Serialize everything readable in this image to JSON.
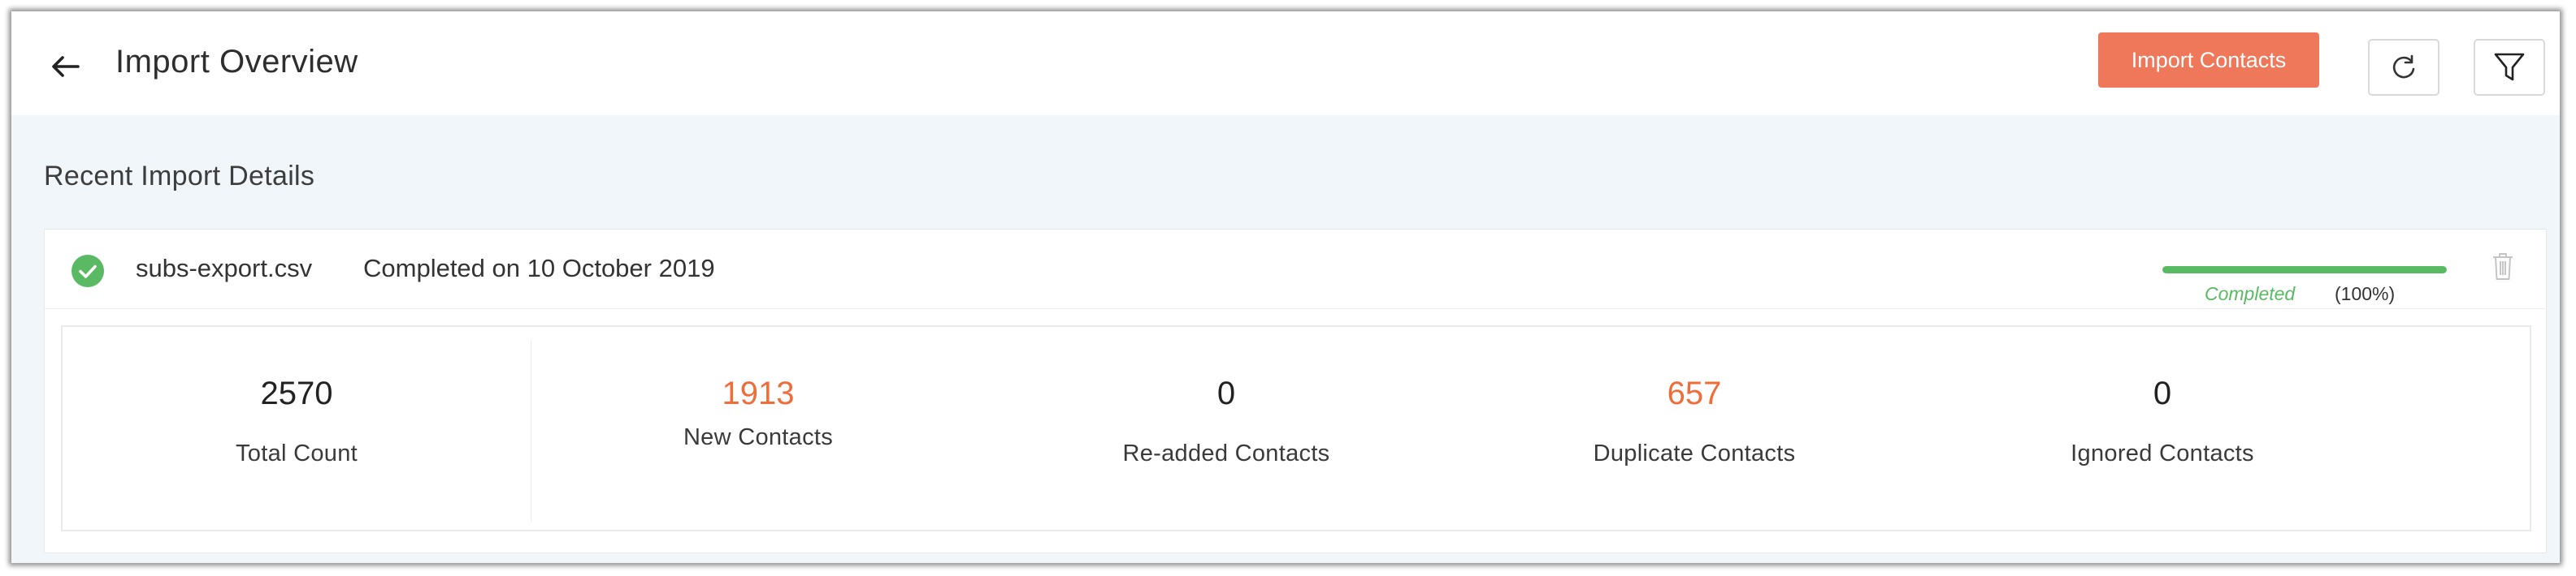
{
  "header": {
    "title": "Import Overview",
    "import_button_label": "Import Contacts"
  },
  "section": {
    "title": "Recent Import Details"
  },
  "import_item": {
    "file_name": "subs-export.csv",
    "completed_text": "Completed on 10 October 2019",
    "progress": {
      "status": "Completed",
      "percent_label": "(100%)",
      "value": 1.0,
      "color": "#5ab963"
    },
    "stats": [
      {
        "value": "2570",
        "label": "Total Count",
        "highlight": false
      },
      {
        "value": "1913",
        "label": "New Contacts",
        "highlight": true
      },
      {
        "value": "0",
        "label": "Re-added Contacts",
        "highlight": false
      },
      {
        "value": "657",
        "label": "Duplicate Contacts",
        "highlight": true
      },
      {
        "value": "0",
        "label": "Ignored Contacts",
        "highlight": false
      }
    ]
  },
  "colors": {
    "accent": "#ee7859",
    "highlight_value": "#ee6d3a",
    "success": "#5ab963",
    "section_background": "#f1f6fa"
  },
  "icons": {
    "back": "arrow-left-icon",
    "refresh": "refresh-icon",
    "filter": "filter-icon",
    "status": "check-circle-icon",
    "delete": "trash-icon"
  }
}
